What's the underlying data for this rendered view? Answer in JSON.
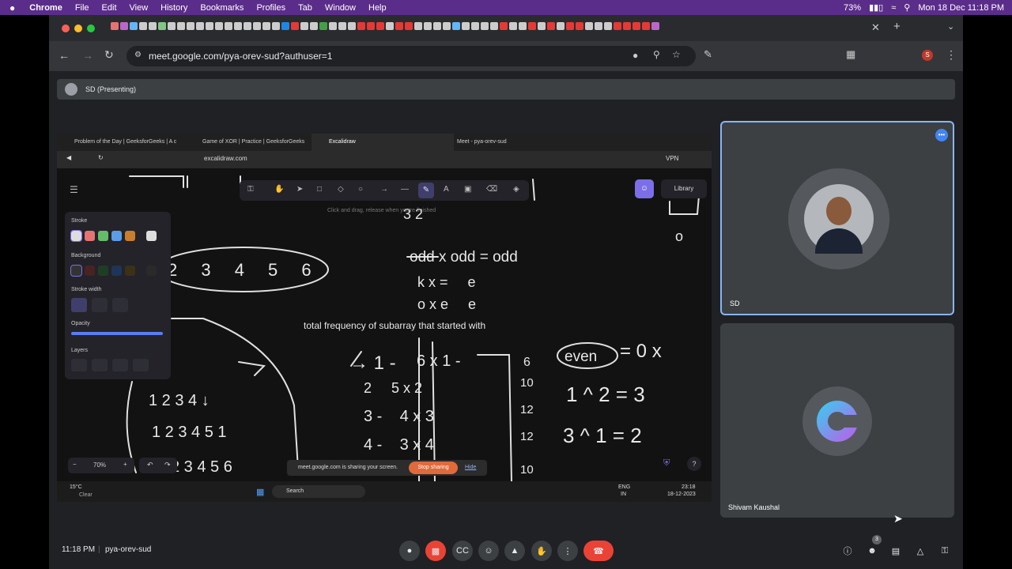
{
  "menubar": {
    "apple": "",
    "app": "Chrome",
    "items": [
      "File",
      "Edit",
      "View",
      "History",
      "Bookmarks",
      "Profiles",
      "Tab",
      "Window",
      "Help"
    ],
    "battery": "73%",
    "datetime": "Mon 18 Dec  11:18 PM"
  },
  "browser": {
    "url": "meet.google.com/pya-orev-sud?authuser=1"
  },
  "meet": {
    "presenting_label": "SD (Presenting)",
    "tiles": [
      {
        "name": "SD"
      },
      {
        "name": "Shivam Kaushal"
      }
    ],
    "time": "11:18 PM",
    "meeting_code": "pya-orev-sud",
    "people_count": "3"
  },
  "shared_screen": {
    "tabs": [
      "Problem of the Day | GeeksforGeeks | A c",
      "Game of XOR | Practice | GeeksforGeeks",
      "Excalidraw",
      "Meet - pya-orev-sud"
    ],
    "address": "excalidraw.com",
    "vpn": "VPN",
    "library": "Library",
    "hint": "Click and drag, release when you're finished",
    "panel": {
      "stroke": "Stroke",
      "background": "Background",
      "stroke_width": "Stroke width",
      "opacity": "Opacity",
      "layers": "Layers"
    },
    "zoom": "70%",
    "sharing_text": "meet.google.com is sharing your screen.",
    "stop_sharing": "Stop sharing",
    "hide": "Hide",
    "taskbar": {
      "weather_temp": "15°C",
      "weather_desc": "Clear",
      "search": "Search",
      "lang1": "ENG",
      "lang2": "IN",
      "clock_time": "23:18",
      "clock_date": "18-12-2023"
    },
    "canvas_text": {
      "odd_odd": "odd x odd = odd",
      "total_frequency": "total frequency of subarray that started with",
      "even": "even",
      "eq_zero": "= 0  x",
      "row1": "1 ^ 2 = 3",
      "row2": "3 ^ 1 = 2",
      "numbers": "2 3 4 5 6"
    }
  },
  "colors": {
    "menubar": "#5b2d8a",
    "meet_bg": "#202124",
    "tile_bg": "#3c4043",
    "active_border": "#8ab4f8",
    "end_call": "#ea4335",
    "stop_sharing": "#e06a3a"
  }
}
